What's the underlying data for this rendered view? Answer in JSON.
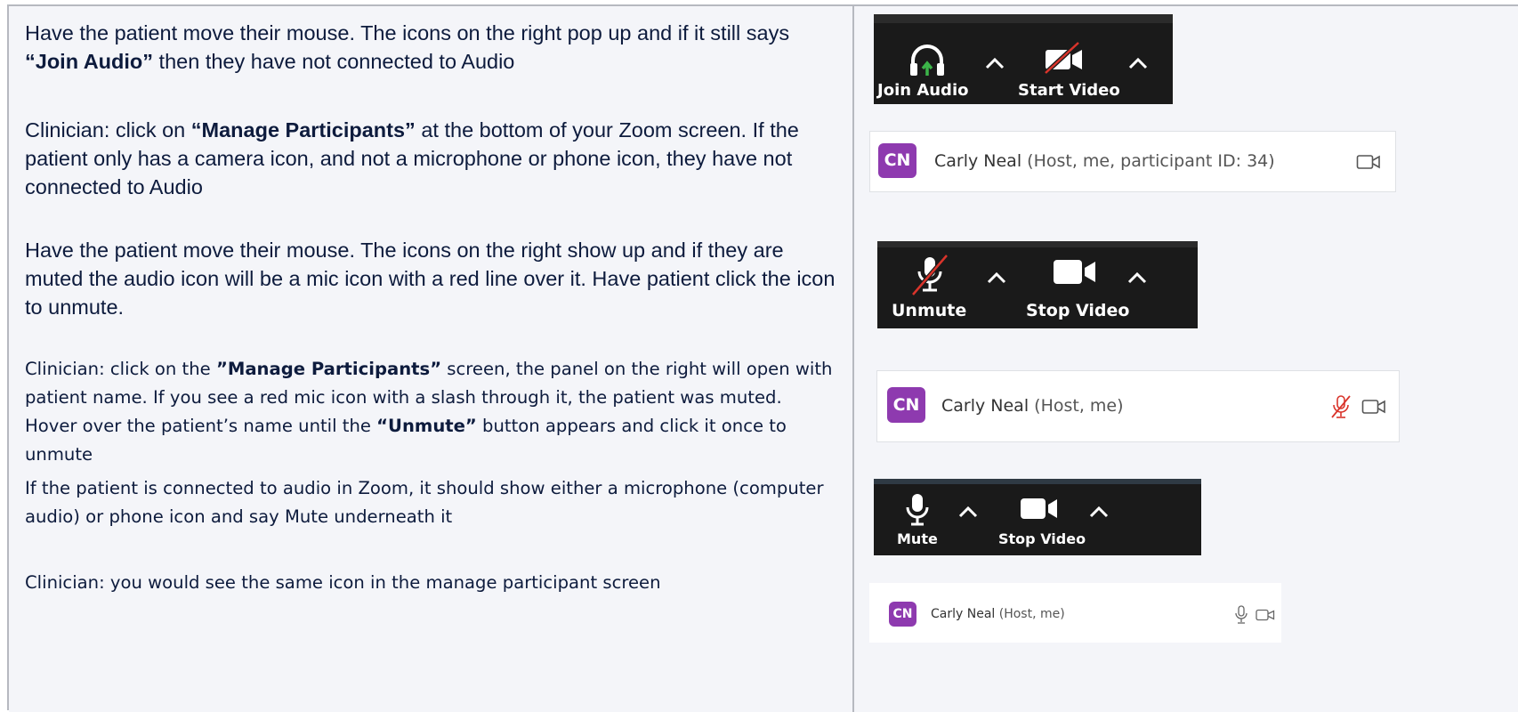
{
  "rows": [
    {
      "text_parts": [
        "Have the patient move their mouse. The icons on the right pop up and if it still says ",
        "“Join Audio”",
        " then they have not connected to Audio"
      ],
      "widget": {
        "type": "toolbar",
        "audio_label": "Join Audio",
        "video_label": "Start Video",
        "audio_icon": "headphones-up-arrow-icon",
        "video_icon": "video-off-icon"
      }
    },
    {
      "text_parts": [
        "Clinician: click on ",
        "“Manage Participants”",
        " at the bottom of your Zoom screen.  If the patient only has a camera icon, and not a microphone or phone icon, they have not connected to Audio"
      ],
      "widget": {
        "type": "participant",
        "initials": "CN",
        "name": "Carly Neal",
        "role": "(Host, me, participant ID: 34)",
        "icons": [
          "video-outline-icon"
        ]
      }
    },
    {
      "text_parts": [
        "Have the patient move their mouse.  The icons on the right show up and if they are muted the audio icon will be a mic icon with a red line over it.  Have patient click the icon to unmute."
      ],
      "widget": {
        "type": "toolbar",
        "audio_label": "Unmute",
        "video_label": "Stop Video",
        "audio_icon": "mic-muted-icon",
        "video_icon": "video-camera-icon"
      }
    },
    {
      "text_parts": [
        "Clinician: click on the ",
        "”Manage Participants”",
        " screen, the panel on the right will open with patient name. If you see a red mic icon with a slash through it, the patient was muted.  Hover over the patient’s name until the ",
        "“Unmute”",
        " button appears and click it once to unmute"
      ],
      "widget": {
        "type": "participant",
        "initials": "CN",
        "name": "Carly Neal",
        "role": "(Host, me)",
        "icons": [
          "mic-muted-red-icon",
          "video-outline-icon"
        ]
      }
    },
    {
      "text_parts": [
        "If the patient is connected to audio in Zoom, it should show either a microphone (computer audio) or phone icon and say Mute underneath it"
      ],
      "widget": {
        "type": "toolbar",
        "audio_label": "Mute",
        "video_label": "Stop Video",
        "audio_icon": "mic-icon",
        "video_icon": "video-camera-icon"
      }
    },
    {
      "text_parts": [
        "Clinician: you would see the same icon in the manage participant screen"
      ],
      "widget": {
        "type": "participant",
        "initials": "CN",
        "name": "Carly Neal",
        "role": "(Host, me)",
        "icons": [
          "mic-outline-icon",
          "video-outline-icon"
        ]
      }
    }
  ],
  "colors": {
    "avatar": "#8e3aaf",
    "muted_red": "#d9342b",
    "join_green": "#3cb449",
    "toolbar_bg": "#1a1a1a"
  }
}
